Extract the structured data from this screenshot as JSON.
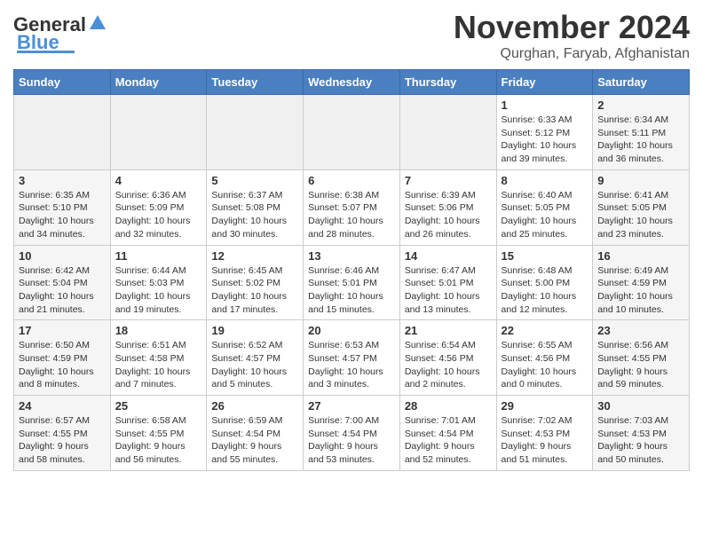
{
  "logo": {
    "line1": "General",
    "line2": "Blue"
  },
  "title": "November 2024",
  "location": "Qurghan, Faryab, Afghanistan",
  "header": {
    "accent_color": "#4a7fc1"
  },
  "days_of_week": [
    "Sunday",
    "Monday",
    "Tuesday",
    "Wednesday",
    "Thursday",
    "Friday",
    "Saturday"
  ],
  "weeks": [
    [
      {
        "day": "",
        "empty": true
      },
      {
        "day": "",
        "empty": true
      },
      {
        "day": "",
        "empty": true
      },
      {
        "day": "",
        "empty": true
      },
      {
        "day": "",
        "empty": true
      },
      {
        "day": "1",
        "sunrise": "Sunrise: 6:33 AM",
        "sunset": "Sunset: 5:12 PM",
        "daylight": "Daylight: 10 hours and 39 minutes."
      },
      {
        "day": "2",
        "sunrise": "Sunrise: 6:34 AM",
        "sunset": "Sunset: 5:11 PM",
        "daylight": "Daylight: 10 hours and 36 minutes."
      }
    ],
    [
      {
        "day": "3",
        "sunrise": "Sunrise: 6:35 AM",
        "sunset": "Sunset: 5:10 PM",
        "daylight": "Daylight: 10 hours and 34 minutes."
      },
      {
        "day": "4",
        "sunrise": "Sunrise: 6:36 AM",
        "sunset": "Sunset: 5:09 PM",
        "daylight": "Daylight: 10 hours and 32 minutes."
      },
      {
        "day": "5",
        "sunrise": "Sunrise: 6:37 AM",
        "sunset": "Sunset: 5:08 PM",
        "daylight": "Daylight: 10 hours and 30 minutes."
      },
      {
        "day": "6",
        "sunrise": "Sunrise: 6:38 AM",
        "sunset": "Sunset: 5:07 PM",
        "daylight": "Daylight: 10 hours and 28 minutes."
      },
      {
        "day": "7",
        "sunrise": "Sunrise: 6:39 AM",
        "sunset": "Sunset: 5:06 PM",
        "daylight": "Daylight: 10 hours and 26 minutes."
      },
      {
        "day": "8",
        "sunrise": "Sunrise: 6:40 AM",
        "sunset": "Sunset: 5:05 PM",
        "daylight": "Daylight: 10 hours and 25 minutes."
      },
      {
        "day": "9",
        "sunrise": "Sunrise: 6:41 AM",
        "sunset": "Sunset: 5:05 PM",
        "daylight": "Daylight: 10 hours and 23 minutes."
      }
    ],
    [
      {
        "day": "10",
        "sunrise": "Sunrise: 6:42 AM",
        "sunset": "Sunset: 5:04 PM",
        "daylight": "Daylight: 10 hours and 21 minutes."
      },
      {
        "day": "11",
        "sunrise": "Sunrise: 6:44 AM",
        "sunset": "Sunset: 5:03 PM",
        "daylight": "Daylight: 10 hours and 19 minutes."
      },
      {
        "day": "12",
        "sunrise": "Sunrise: 6:45 AM",
        "sunset": "Sunset: 5:02 PM",
        "daylight": "Daylight: 10 hours and 17 minutes."
      },
      {
        "day": "13",
        "sunrise": "Sunrise: 6:46 AM",
        "sunset": "Sunset: 5:01 PM",
        "daylight": "Daylight: 10 hours and 15 minutes."
      },
      {
        "day": "14",
        "sunrise": "Sunrise: 6:47 AM",
        "sunset": "Sunset: 5:01 PM",
        "daylight": "Daylight: 10 hours and 13 minutes."
      },
      {
        "day": "15",
        "sunrise": "Sunrise: 6:48 AM",
        "sunset": "Sunset: 5:00 PM",
        "daylight": "Daylight: 10 hours and 12 minutes."
      },
      {
        "day": "16",
        "sunrise": "Sunrise: 6:49 AM",
        "sunset": "Sunset: 4:59 PM",
        "daylight": "Daylight: 10 hours and 10 minutes."
      }
    ],
    [
      {
        "day": "17",
        "sunrise": "Sunrise: 6:50 AM",
        "sunset": "Sunset: 4:59 PM",
        "daylight": "Daylight: 10 hours and 8 minutes."
      },
      {
        "day": "18",
        "sunrise": "Sunrise: 6:51 AM",
        "sunset": "Sunset: 4:58 PM",
        "daylight": "Daylight: 10 hours and 7 minutes."
      },
      {
        "day": "19",
        "sunrise": "Sunrise: 6:52 AM",
        "sunset": "Sunset: 4:57 PM",
        "daylight": "Daylight: 10 hours and 5 minutes."
      },
      {
        "day": "20",
        "sunrise": "Sunrise: 6:53 AM",
        "sunset": "Sunset: 4:57 PM",
        "daylight": "Daylight: 10 hours and 3 minutes."
      },
      {
        "day": "21",
        "sunrise": "Sunrise: 6:54 AM",
        "sunset": "Sunset: 4:56 PM",
        "daylight": "Daylight: 10 hours and 2 minutes."
      },
      {
        "day": "22",
        "sunrise": "Sunrise: 6:55 AM",
        "sunset": "Sunset: 4:56 PM",
        "daylight": "Daylight: 10 hours and 0 minutes."
      },
      {
        "day": "23",
        "sunrise": "Sunrise: 6:56 AM",
        "sunset": "Sunset: 4:55 PM",
        "daylight": "Daylight: 9 hours and 59 minutes."
      }
    ],
    [
      {
        "day": "24",
        "sunrise": "Sunrise: 6:57 AM",
        "sunset": "Sunset: 4:55 PM",
        "daylight": "Daylight: 9 hours and 58 minutes."
      },
      {
        "day": "25",
        "sunrise": "Sunrise: 6:58 AM",
        "sunset": "Sunset: 4:55 PM",
        "daylight": "Daylight: 9 hours and 56 minutes."
      },
      {
        "day": "26",
        "sunrise": "Sunrise: 6:59 AM",
        "sunset": "Sunset: 4:54 PM",
        "daylight": "Daylight: 9 hours and 55 minutes."
      },
      {
        "day": "27",
        "sunrise": "Sunrise: 7:00 AM",
        "sunset": "Sunset: 4:54 PM",
        "daylight": "Daylight: 9 hours and 53 minutes."
      },
      {
        "day": "28",
        "sunrise": "Sunrise: 7:01 AM",
        "sunset": "Sunset: 4:54 PM",
        "daylight": "Daylight: 9 hours and 52 minutes."
      },
      {
        "day": "29",
        "sunrise": "Sunrise: 7:02 AM",
        "sunset": "Sunset: 4:53 PM",
        "daylight": "Daylight: 9 hours and 51 minutes."
      },
      {
        "day": "30",
        "sunrise": "Sunrise: 7:03 AM",
        "sunset": "Sunset: 4:53 PM",
        "daylight": "Daylight: 9 hours and 50 minutes."
      }
    ]
  ]
}
